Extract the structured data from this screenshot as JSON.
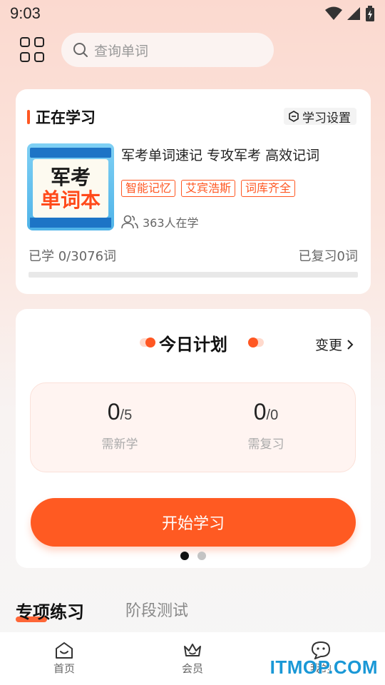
{
  "status_bar": {
    "time": "9:03"
  },
  "header": {
    "search_placeholder": "查询单词"
  },
  "learning": {
    "section_title": "正在学习",
    "settings_label": "学习设置",
    "book": {
      "cover_title_line1": "军考",
      "cover_title_line2": "单词本",
      "title": "军考单词速记 专攻军考 高效记词",
      "tags": [
        "智能记忆",
        "艾宾浩斯",
        "词库齐全"
      ],
      "learners": "363人在学"
    },
    "learned_text": "已学 0/3076词",
    "reviewed_text": "已复习0词",
    "progress_fraction": 0
  },
  "plan": {
    "title": "今日计划",
    "change_label": "变更",
    "new_count": "0",
    "new_total": "/5",
    "new_label": "需新学",
    "review_count": "0",
    "review_total": "/0",
    "review_label": "需复习",
    "start_label": "开始学习"
  },
  "tabs": {
    "active": "专项练习",
    "inactive": "阶段测试"
  },
  "bottom_nav": [
    {
      "label": "首页"
    },
    {
      "label": "会员"
    },
    {
      "label": "我的"
    }
  ],
  "watermark": "ITMOP.COM",
  "colors": {
    "accent": "#ff5722",
    "watermark": "#1a98d6"
  }
}
